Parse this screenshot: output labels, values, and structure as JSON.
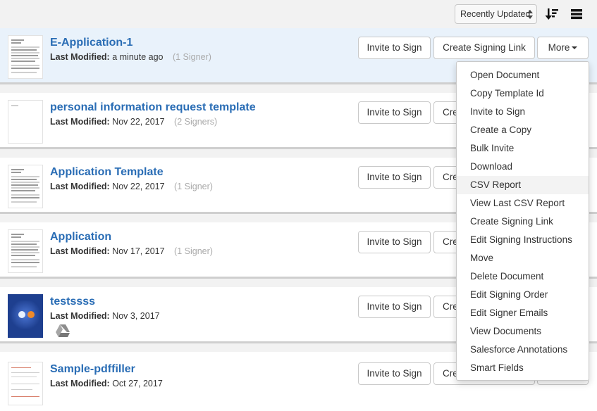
{
  "toolbar": {
    "sort_value": "Recently Updated",
    "sort_icon": "sort-descending-icon",
    "view_icon": "list-view-icon"
  },
  "labels": {
    "last_modified": "Last Modified:",
    "invite": "Invite to Sign",
    "create_link": "Create Signing Link",
    "create_link_truncated": "Cre",
    "more": "More"
  },
  "documents": [
    {
      "title": "E-Application-1",
      "modified": "a minute ago",
      "signers": "(1 Signer)",
      "active": true
    },
    {
      "title": "personal information request template",
      "modified": "Nov 22, 2017",
      "signers": "(2 Signers)"
    },
    {
      "title": "Application Template",
      "modified": "Nov 22, 2017",
      "signers": "(1 Signer)"
    },
    {
      "title": "Application",
      "modified": "Nov 17, 2017",
      "signers": "(1 Signer)"
    },
    {
      "title": "testssss",
      "modified": "Nov 3, 2017",
      "signers": "",
      "badge_icon": "google-drive-icon"
    },
    {
      "title": "Sample-pdffiller",
      "modified": "Oct 27, 2017",
      "signers": ""
    }
  ],
  "more_menu": {
    "items": [
      "Open Document",
      "Copy Template Id",
      "Invite to Sign",
      "Create a Copy",
      "Bulk Invite",
      "Download",
      "CSV Report",
      "View Last CSV Report",
      "Create Signing Link",
      "Edit Signing Instructions",
      "Move",
      "Delete Document",
      "Edit Signing Order",
      "Edit Signer Emails",
      "View Documents",
      "Salesforce Annotations",
      "Smart Fields"
    ],
    "highlighted": "CSV Report"
  },
  "colors": {
    "link": "#2a6db5",
    "active_row": "#e9f2fb",
    "background": "#f2f2f2"
  }
}
